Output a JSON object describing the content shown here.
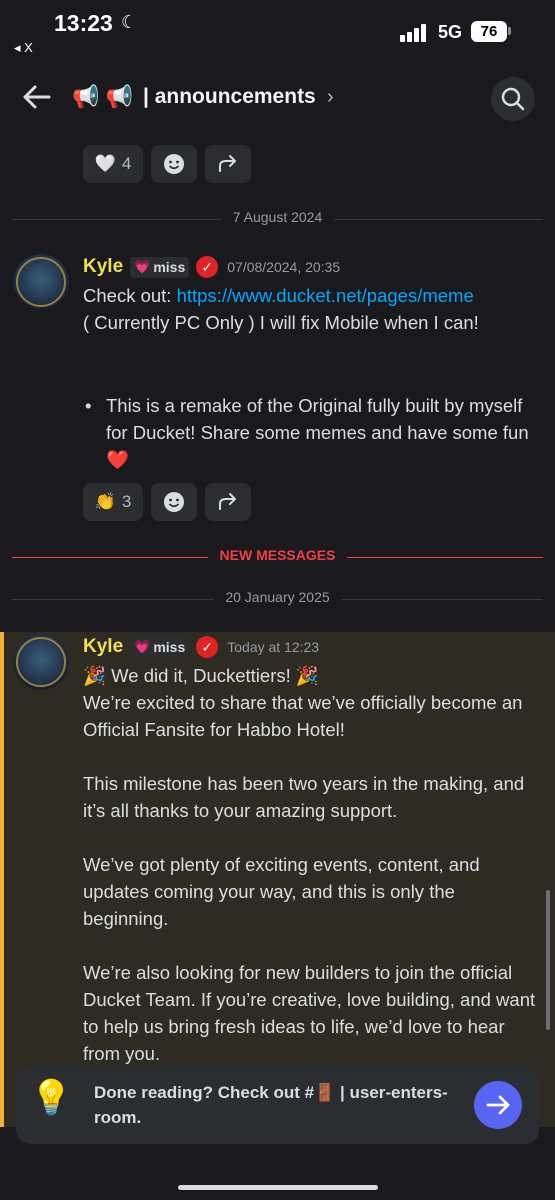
{
  "status_bar": {
    "time": "13:23",
    "back_app": "◂ X",
    "network": "5G",
    "battery": "76"
  },
  "header": {
    "channel_emoji": "📢 📢",
    "channel_name": "| announcements",
    "chevron": "›"
  },
  "top_reactions": {
    "heart_emoji": "🤍",
    "heart_count": "4"
  },
  "dividers": {
    "date1": "7 August 2024",
    "new_messages": "NEW MESSAGES",
    "date2": "20 January 2025"
  },
  "message1": {
    "author": "Kyle",
    "tag": "miss",
    "timestamp": "07/08/2024, 20:35",
    "line1_prefix": "Check out: ",
    "link": "https://www.ducket.net/pages/meme",
    "line2": "( Currently PC Only ) I will fix Mobile when I can!",
    "bullet": "This is a remake of the Original fully built by myself for Ducket! Share some memes and have some fun ❤️",
    "reaction_emoji": "👏",
    "reaction_count": "3"
  },
  "message2": {
    "author": "Kyle",
    "tag": "miss",
    "timestamp": "Today at 12:23",
    "para1_line1": "🎉 We did it, Duckettiers! 🎉",
    "para1_line2": "We’re excited to share that we’ve officially become an Official Fansite for Habbo Hotel!",
    "para2": "This milestone has been two years in the making, and it’s all thanks to your amazing support.",
    "para3": "We’ve got plenty of exciting events, content, and updates coming your way, and this is only the beginning.",
    "para4": "We’re also looking for new builders to join the official Ducket Team. If you’re creative, love building, and want to help us bring fresh ideas to life, we’d love to hear from you."
  },
  "banner": {
    "text": "Done reading? Check out #🚪 | user-enters-room."
  },
  "colors": {
    "background": "#1a1a1e",
    "author": "#f0e050",
    "link": "#00a8fc",
    "new_messages": "#f23f43",
    "highlight_bar": "#f0b232",
    "accent": "#5865f2"
  }
}
